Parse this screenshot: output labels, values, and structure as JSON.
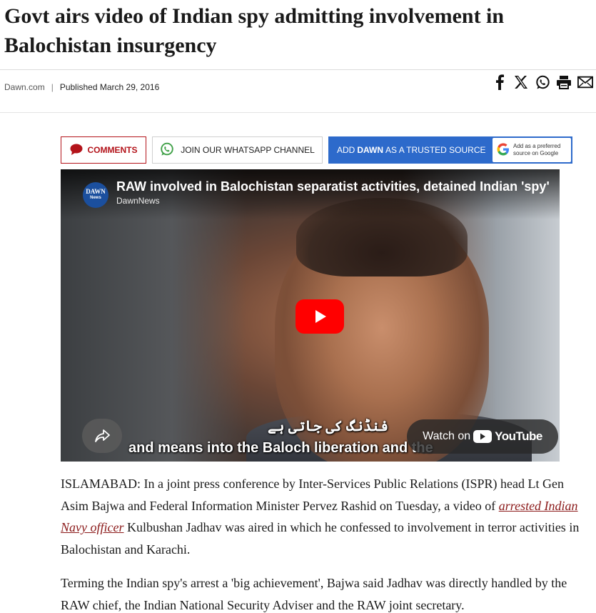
{
  "article": {
    "headline": "Govt airs video of Indian spy admitting involvement in Balochistan insurgency",
    "source": "Dawn.com",
    "separator": "|",
    "published": "Published March 29, 2016"
  },
  "share_icons": [
    "facebook-icon",
    "x-icon",
    "whatsapp-icon",
    "print-icon",
    "email-icon"
  ],
  "buttons": {
    "comments": "COMMENTS",
    "whatsapp": "JOIN OUR WHATSAPP CHANNEL",
    "trusted_prefix": "ADD",
    "trusted_brand": "DAWN",
    "trusted_suffix": "AS A TRUSTED SOURCE",
    "google_badge_line1": "Add as a preferred",
    "google_badge_line2": "source on Google"
  },
  "video": {
    "channel_logo_line1": "DAWN",
    "channel_logo_line2": "News",
    "title": "RAW involved in Balochistan separatist activities, detained Indian 'spy'",
    "channel": "DawnNews",
    "subtitle_urdu": "فنڈنگ کی جاتی ہے",
    "subtitle_en": "and means into the Baloch liberation and the",
    "watch_on": "Watch on",
    "youtube": "YouTube"
  },
  "body": {
    "p1_before": "ISLAMABAD: In a joint press conference by Inter-Services Public Relations (ISPR) head Lt Gen Asim Bajwa and Federal Information Minister Pervez Rashid on Tuesday, a video of ",
    "p1_link": "arrested Indian Navy officer",
    "p1_after": " Kulbushan Jadhav was aired in which he confessed to involvement in terror activities in Balochistan and Karachi.",
    "p2": "Terming the Indian spy's arrest a 'big achievement', Bajwa said Jadhav was directly handled by the RAW chief, the Indian National Security Adviser and the RAW joint secretary."
  },
  "colors": {
    "brand_red": "#b3131a",
    "trusted_blue": "#2d6acb",
    "link": "#8b1a1a",
    "youtube_red": "#ff0000"
  }
}
